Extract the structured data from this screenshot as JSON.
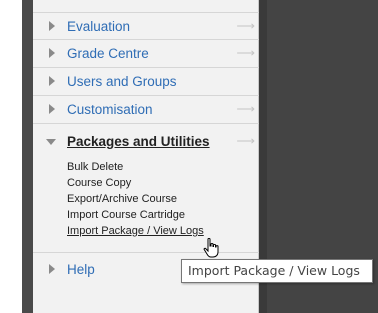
{
  "menu": {
    "items": [
      {
        "label": "Evaluation"
      },
      {
        "label": "Grade Centre"
      },
      {
        "label": "Users and Groups"
      },
      {
        "label": "Customisation"
      },
      {
        "label": "Packages and Utilities"
      },
      {
        "label": "Help"
      }
    ],
    "submenu": [
      {
        "label": "Bulk Delete"
      },
      {
        "label": "Course Copy"
      },
      {
        "label": "Export/Archive Course"
      },
      {
        "label": "Import Course Cartridge"
      },
      {
        "label": "Import Package / View Logs"
      }
    ],
    "arrow_glyph": "⟶"
  },
  "tooltip": {
    "text": "Import Package / View Logs"
  },
  "colors": {
    "link": "#2f6db5",
    "panel": "#f2f2f2",
    "dark_bg": "#444444"
  }
}
